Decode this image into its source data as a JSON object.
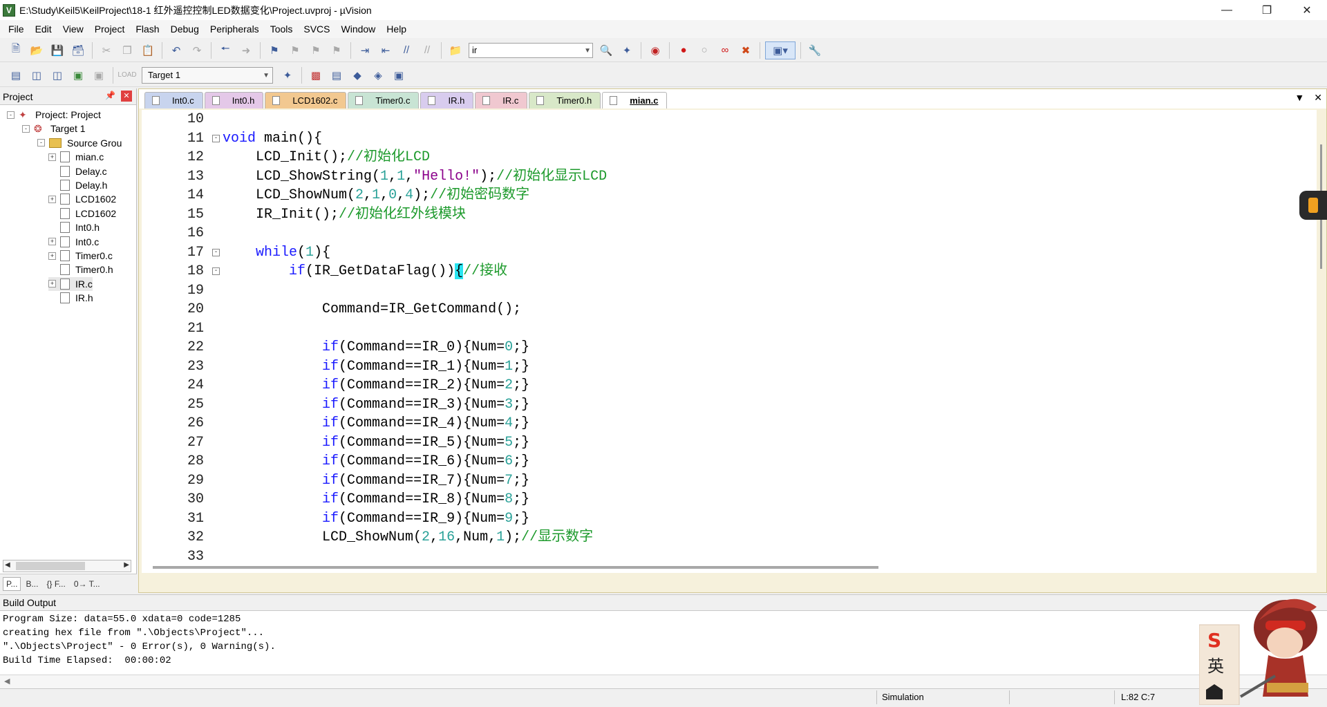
{
  "window": {
    "title": "E:\\Study\\Keil5\\KeilProject\\18-1 红外遥控控制LED数据变化\\Project.uvproj - µVision",
    "app_icon": "V",
    "controls": [
      "minimize-icon",
      "restore-icon",
      "close-icon"
    ]
  },
  "menu": [
    "File",
    "Edit",
    "View",
    "Project",
    "Flash",
    "Debug",
    "Peripherals",
    "Tools",
    "SVCS",
    "Window",
    "Help"
  ],
  "toolbar": {
    "search_value": "ir",
    "target_value": "Target 1"
  },
  "project_panel": {
    "title": "Project",
    "tree": [
      {
        "label": "Project: Project",
        "level": 0,
        "expander": "-",
        "icon": "project-icon"
      },
      {
        "label": "Target 1",
        "level": 1,
        "expander": "-",
        "icon": "target-icon"
      },
      {
        "label": "Source Grou",
        "level": 2,
        "expander": "-",
        "icon": "folder-icon"
      },
      {
        "label": "mian.c",
        "level": 3,
        "expander": "+",
        "icon": "file-icon"
      },
      {
        "label": "Delay.c",
        "level": 3,
        "expander": "",
        "icon": "file-icon"
      },
      {
        "label": "Delay.h",
        "level": 3,
        "expander": "",
        "icon": "file-icon"
      },
      {
        "label": "LCD1602",
        "level": 3,
        "expander": "+",
        "icon": "file-icon"
      },
      {
        "label": "LCD1602",
        "level": 3,
        "expander": "",
        "icon": "file-icon"
      },
      {
        "label": "Int0.h",
        "level": 3,
        "expander": "",
        "icon": "file-icon"
      },
      {
        "label": "Int0.c",
        "level": 3,
        "expander": "+",
        "icon": "file-icon"
      },
      {
        "label": "Timer0.c",
        "level": 3,
        "expander": "+",
        "icon": "file-icon"
      },
      {
        "label": "Timer0.h",
        "level": 3,
        "expander": "",
        "icon": "file-icon"
      },
      {
        "label": "IR.c",
        "level": 3,
        "expander": "+",
        "icon": "file-icon"
      },
      {
        "label": "IR.h",
        "level": 3,
        "expander": "",
        "icon": "file-icon"
      }
    ],
    "bottom_tabs": [
      "P...",
      "B...",
      "{} F...",
      "0→ T..."
    ]
  },
  "editor": {
    "tabs": [
      {
        "label": "Int0.c",
        "color": "#c8d4ee"
      },
      {
        "label": "Int0.h",
        "color": "#e4c8e8"
      },
      {
        "label": "LCD1602.c",
        "color": "#f2c890"
      },
      {
        "label": "Timer0.c",
        "color": "#c8e4d4"
      },
      {
        "label": "IR.h",
        "color": "#d8ccee"
      },
      {
        "label": "IR.c",
        "color": "#f0c8d0"
      },
      {
        "label": "Timer0.h",
        "color": "#d8e8c8"
      },
      {
        "label": "mian.c",
        "color": "#ffffff",
        "active": true
      }
    ],
    "lines": [
      {
        "n": "10",
        "fold": "",
        "html": ""
      },
      {
        "n": "11",
        "fold": "-",
        "html": "<span class=\"kw\">void</span> main(){"
      },
      {
        "n": "12",
        "fold": "",
        "html": "    LCD_Init();<span class=\"cmt\">//初始化LCD</span>"
      },
      {
        "n": "13",
        "fold": "",
        "html": "    LCD_ShowString(<span class=\"num\">1</span>,<span class=\"num\">1</span>,<span class=\"str\">\"Hello!\"</span>);<span class=\"cmt\">//初始化显示LCD</span>"
      },
      {
        "n": "14",
        "fold": "",
        "html": "    LCD_ShowNum(<span class=\"num\">2</span>,<span class=\"num\">1</span>,<span class=\"num\">0</span>,<span class=\"num\">4</span>);<span class=\"cmt\">//初始密码数字</span>"
      },
      {
        "n": "15",
        "fold": "",
        "html": "    IR_Init();<span class=\"cmt\">//初始化红外线模块</span>"
      },
      {
        "n": "16",
        "fold": "",
        "html": ""
      },
      {
        "n": "17",
        "fold": "-",
        "html": "    <span class=\"kw\">while</span>(<span class=\"num\">1</span>){"
      },
      {
        "n": "18",
        "fold": "-",
        "html": "        <span class=\"kw\">if</span>(IR_GetDataFlag())<span class=\"caret\">{</span><span class=\"cmt\">//接收</span>"
      },
      {
        "n": "19",
        "fold": "",
        "html": ""
      },
      {
        "n": "20",
        "fold": "",
        "html": "            Command=IR_GetCommand();"
      },
      {
        "n": "21",
        "fold": "",
        "html": ""
      },
      {
        "n": "22",
        "fold": "",
        "html": "            <span class=\"kw\">if</span>(Command==IR_0){Num=<span class=\"num\">0</span>;}"
      },
      {
        "n": "23",
        "fold": "",
        "html": "            <span class=\"kw\">if</span>(Command==IR_1){Num=<span class=\"num\">1</span>;}"
      },
      {
        "n": "24",
        "fold": "",
        "html": "            <span class=\"kw\">if</span>(Command==IR_2){Num=<span class=\"num\">2</span>;}"
      },
      {
        "n": "25",
        "fold": "",
        "html": "            <span class=\"kw\">if</span>(Command==IR_3){Num=<span class=\"num\">3</span>;}"
      },
      {
        "n": "26",
        "fold": "",
        "html": "            <span class=\"kw\">if</span>(Command==IR_4){Num=<span class=\"num\">4</span>;}"
      },
      {
        "n": "27",
        "fold": "",
        "html": "            <span class=\"kw\">if</span>(Command==IR_5){Num=<span class=\"num\">5</span>;}"
      },
      {
        "n": "28",
        "fold": "",
        "html": "            <span class=\"kw\">if</span>(Command==IR_6){Num=<span class=\"num\">6</span>;}"
      },
      {
        "n": "29",
        "fold": "",
        "html": "            <span class=\"kw\">if</span>(Command==IR_7){Num=<span class=\"num\">7</span>;}"
      },
      {
        "n": "30",
        "fold": "",
        "html": "            <span class=\"kw\">if</span>(Command==IR_8){Num=<span class=\"num\">8</span>;}"
      },
      {
        "n": "31",
        "fold": "",
        "html": "            <span class=\"kw\">if</span>(Command==IR_9){Num=<span class=\"num\">9</span>;}"
      },
      {
        "n": "32",
        "fold": "",
        "html": "            LCD_ShowNum(<span class=\"num\">2</span>,<span class=\"num\">16</span>,Num,<span class=\"num\">1</span>);<span class=\"cmt\">//显示数字</span>"
      },
      {
        "n": "33",
        "fold": "",
        "html": ""
      }
    ]
  },
  "build": {
    "title": "Build Output",
    "lines": [
      "Program Size: data=55.0 xdata=0 code=1285",
      "creating hex file from \".\\Objects\\Project\"...",
      "\".\\Objects\\Project\" - 0 Error(s), 0 Warning(s).",
      "Build Time Elapsed:  00:00:02"
    ]
  },
  "status": {
    "mode": "Simulation",
    "position": "L:82 C:7"
  },
  "mascot": {
    "badge": "S",
    "char": "英"
  }
}
